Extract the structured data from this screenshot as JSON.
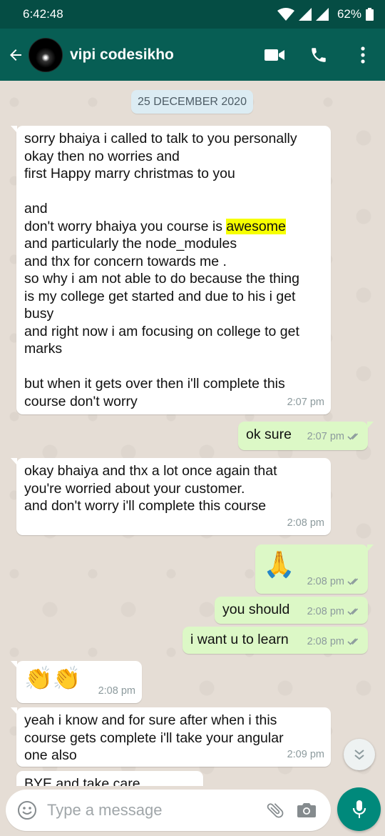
{
  "status_bar": {
    "time": "6:42:48",
    "battery": "62%"
  },
  "header": {
    "contact_name": "vipi codesikho"
  },
  "chat": {
    "date_chip": "25 DECEMBER 2020",
    "messages": [
      {
        "dir": "in",
        "text_before": "sorry bhaiya i called to talk to you personally\nokay then no worries and\nfirst Happy marry christmas to you\n\nand\ndon't worry bhaiya you course is ",
        "highlight": "awesome",
        "text_after": "\nand particularly the node_modules\nand thx for concern towards me .\nso why i am not able to do because the thing\nis my college get started and due to his i get\nbusy\nand right now i am focusing on college to get\nmarks\n\nbut when it gets over then i'll complete this\ncourse don't worry",
        "time": "2:07 pm"
      },
      {
        "dir": "out",
        "text": "ok sure",
        "time": "2:07 pm"
      },
      {
        "dir": "in",
        "text": "okay bhaiya and thx a lot once again that\nyou're worried about your customer.\nand don't worry i'll complete this course",
        "time": "2:08 pm"
      },
      {
        "dir": "out",
        "text": "🙏",
        "time": "2:08 pm"
      },
      {
        "dir": "out",
        "text": "you should",
        "time": "2:08 pm"
      },
      {
        "dir": "out",
        "text": "i want u to learn",
        "time": "2:08 pm"
      },
      {
        "dir": "in",
        "text": "👏👏",
        "time": "2:08 pm"
      },
      {
        "dir": "in",
        "text": "yeah i know and for sure after when i this\ncourse gets complete i'll take your angular\none also",
        "time": "2:09 pm"
      },
      {
        "dir": "in",
        "text": "BYE and take care",
        "time": ""
      }
    ]
  },
  "composer": {
    "placeholder": "Type a message"
  },
  "colors": {
    "header": "#075e54",
    "status_bar": "#054d44",
    "outgoing": "#dcf8c6",
    "incoming": "#ffffff",
    "fab": "#00897b"
  },
  "icons": [
    "back-arrow-icon",
    "video-call-icon",
    "voice-call-icon",
    "more-options-icon",
    "double-check-icon",
    "scroll-down-icon",
    "emoji-icon",
    "attach-icon",
    "camera-icon",
    "mic-icon"
  ]
}
